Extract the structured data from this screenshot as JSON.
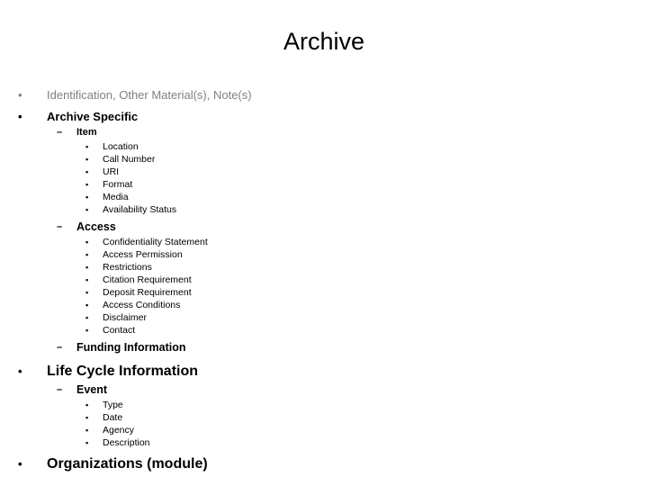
{
  "slide": {
    "title": "Archive",
    "markers": {
      "level1": "•",
      "level2": "–",
      "level3": "▪"
    },
    "colors": {
      "text": "#000000",
      "muted": "#808080",
      "background": "#ffffff"
    },
    "outline": [
      {
        "level": 1,
        "style": "muted",
        "label": "Identification, Other Material(s), Note(s)"
      },
      {
        "level": 1,
        "style": "normal",
        "label": "Archive Specific"
      },
      {
        "level": 2,
        "style": "normal",
        "label": "Item"
      },
      {
        "level": 3,
        "label": "Location"
      },
      {
        "level": 3,
        "label": "Call Number"
      },
      {
        "level": 3,
        "label": "URI"
      },
      {
        "level": 3,
        "label": "Format"
      },
      {
        "level": 3,
        "label": "Media"
      },
      {
        "level": 3,
        "label": "Availability Status"
      },
      {
        "level": 2,
        "style": "med",
        "label": "Access"
      },
      {
        "level": 3,
        "label": "Confidentiality Statement"
      },
      {
        "level": 3,
        "label": "Access Permission"
      },
      {
        "level": 3,
        "label": "Restrictions"
      },
      {
        "level": 3,
        "label": "Citation Requirement"
      },
      {
        "level": 3,
        "label": "Deposit Requirement"
      },
      {
        "level": 3,
        "label": "Access Conditions"
      },
      {
        "level": 3,
        "label": "Disclaimer"
      },
      {
        "level": 3,
        "label": "Contact"
      },
      {
        "level": 2,
        "style": "med",
        "label": "Funding Information"
      },
      {
        "level": 1,
        "style": "big",
        "label": "Life Cycle Information"
      },
      {
        "level": 2,
        "style": "med",
        "label": "Event"
      },
      {
        "level": 3,
        "label": "Type"
      },
      {
        "level": 3,
        "label": "Date"
      },
      {
        "level": 3,
        "label": "Agency"
      },
      {
        "level": 3,
        "label": "Description"
      },
      {
        "level": 1,
        "style": "big",
        "label": "Organizations (module)"
      }
    ]
  }
}
